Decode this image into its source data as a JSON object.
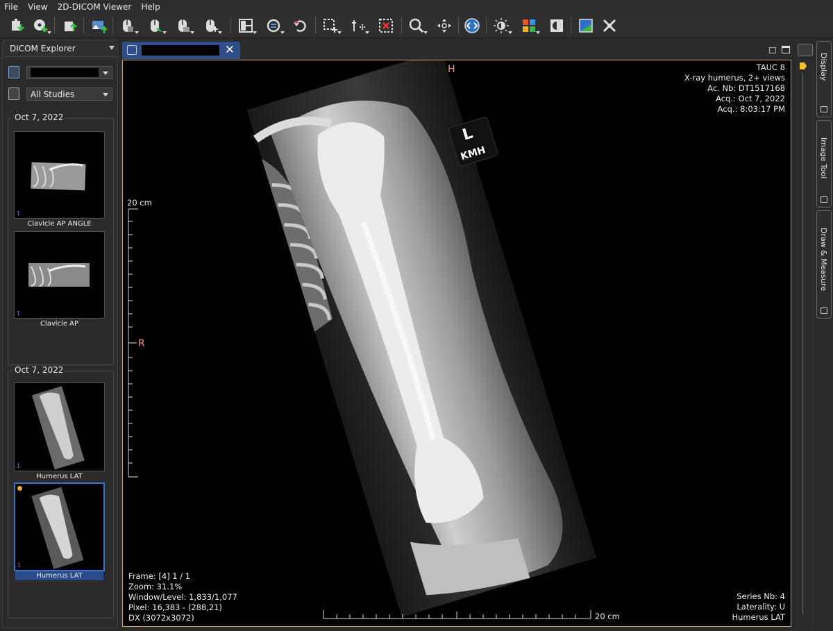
{
  "menu": [
    "File",
    "View",
    "2D-DICOM Viewer",
    "Help"
  ],
  "toolbar": {
    "icons": [
      "import-dicom-icon",
      "import-cd-icon",
      "export-dicom-icon",
      "export-image-icon",
      "mouse-left-action-icon",
      "mouse-middle-action-icon",
      "mouse-right-action-icon",
      "mouse-wheel-action-icon",
      "layout-icon",
      "synch-icon",
      "reset-icon",
      "measure-select-icon",
      "pointer-info-icon",
      "crop-icon",
      "zoom-icon",
      "pan-icon",
      "rotate-icon",
      "brightness-icon",
      "lut-icon",
      "invert-icon",
      "fusion-icon",
      "cine-icon"
    ]
  },
  "explorer": {
    "tab_title": "DICOM Explorer",
    "patient_select": "",
    "studies_select": "All Studies",
    "groups": [
      {
        "date": "Oct 7, 2022",
        "series": [
          {
            "label": "Clavicle AP ANGLE",
            "num": "1"
          },
          {
            "label": "Clavicle AP",
            "num": "1"
          }
        ]
      },
      {
        "date": "Oct 7, 2022",
        "series": [
          {
            "label": "Humerus LAT",
            "num": "1"
          },
          {
            "label": "Humerus LAT",
            "num": "1"
          }
        ]
      }
    ]
  },
  "viewer": {
    "tab_label": "",
    "orientation": {
      "top": "H",
      "left": "R"
    },
    "top_right": {
      "institution": "TAUC 8",
      "study_desc": "X-ray humerus, 2+ views",
      "accession": "Ac. Nb: DT1517168",
      "acq_date": "Acq.: Oct 7, 2022",
      "acq_time": "Acq.: 8:03:17 PM"
    },
    "bottom_left": {
      "frame": "Frame: [4] 1 / 1",
      "zoom": "Zoom: 31.1%",
      "window_level": "Window/Level: 1,833/1,077",
      "pixel": "Pixel: 16,383 - (288,21)",
      "modality": "DX (3072x3072)"
    },
    "bottom_right": {
      "series_nb": "Series Nb: 4",
      "laterality": "Laterality: U",
      "series_desc": "Humerus LAT"
    },
    "scale_v": "20 cm",
    "scale_h": "20 cm",
    "marker": {
      "side": "L",
      "initials": "KMH"
    }
  },
  "dock": {
    "tabs": [
      "Display",
      "Image Tool",
      "Draw & Measure"
    ]
  }
}
